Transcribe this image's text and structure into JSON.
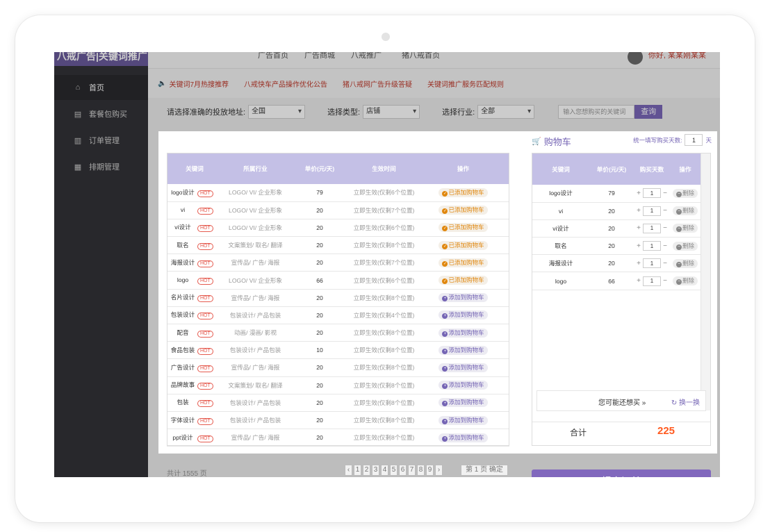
{
  "brand": "八戒广告|关键词推广",
  "sidebar": {
    "items": [
      {
        "label": "首页",
        "icon": "home-icon"
      },
      {
        "label": "套餐包购买",
        "icon": "book-icon"
      },
      {
        "label": "订单管理",
        "icon": "clipboard-icon"
      },
      {
        "label": "排期管理",
        "icon": "calendar-icon"
      }
    ]
  },
  "topnav": {
    "links": [
      "广告首页",
      "广告商城",
      "八戒推广",
      "猪八戒首页"
    ],
    "greeting": "你好,",
    "user": "某某刚某某"
  },
  "notices": [
    "关键词7月热搜推荐",
    "八戒快车产品操作优化公告",
    "猪八戒网广告升级答疑",
    "关键词推广服务匹配规则"
  ],
  "filters": {
    "area_label": "请选择准确的投放地址:",
    "area_value": "全国",
    "type_label": "选择类型:",
    "type_value": "店铺",
    "industry_label": "选择行业:",
    "industry_value": "全部",
    "search_placeholder": "输入您想购买的关键词",
    "search_button": "查询"
  },
  "keyword_table": {
    "headers": [
      "关键词",
      "所属行业",
      "单价(元/天)",
      "生效时间",
      "操作"
    ],
    "hot_label": "HOT",
    "added_label": "已添加购物车",
    "add_label": "添加到购物车",
    "rows": [
      {
        "keyword": "logo设计",
        "industry": "LOGO/ VI/ 企业形象",
        "price": "79",
        "effective": "立即生效(仅剩6个位置)",
        "added": true
      },
      {
        "keyword": "vi",
        "industry": "LOGO/ VI/ 企业形象",
        "price": "20",
        "effective": "立即生效(仅剩7个位置)",
        "added": true
      },
      {
        "keyword": "vi设计",
        "industry": "LOGO/ VI/ 企业形象",
        "price": "20",
        "effective": "立即生效(仅剩6个位置)",
        "added": true
      },
      {
        "keyword": "取名",
        "industry": "文案策划/ 取名/ 翻译",
        "price": "20",
        "effective": "立即生效(仅剩8个位置)",
        "added": true
      },
      {
        "keyword": "海报设计",
        "industry": "宣传品/ 广告/ 海报",
        "price": "20",
        "effective": "立即生效(仅剩7个位置)",
        "added": true
      },
      {
        "keyword": "logo",
        "industry": "LOGO/ VI/ 企业形象",
        "price": "66",
        "effective": "立即生效(仅剩6个位置)",
        "added": true
      },
      {
        "keyword": "名片设计",
        "industry": "宣传品/ 广告/ 海报",
        "price": "20",
        "effective": "立即生效(仅剩8个位置)",
        "added": false
      },
      {
        "keyword": "包装设计",
        "industry": "包装设计/ 产品包装",
        "price": "20",
        "effective": "立即生效(仅剩4个位置)",
        "added": false
      },
      {
        "keyword": "配音",
        "industry": "动画/ 漫画/ 影视",
        "price": "20",
        "effective": "立即生效(仅剩8个位置)",
        "added": false
      },
      {
        "keyword": "食品包装",
        "industry": "包装设计/ 产品包装",
        "price": "10",
        "effective": "立即生效(仅剩8个位置)",
        "added": false
      },
      {
        "keyword": "广告设计",
        "industry": "宣传品/ 广告/ 海报",
        "price": "20",
        "effective": "立即生效(仅剩8个位置)",
        "added": false
      },
      {
        "keyword": "品牌故事",
        "industry": "文案策划/ 取名/ 翻译",
        "price": "20",
        "effective": "立即生效(仅剩8个位置)",
        "added": false
      },
      {
        "keyword": "包装",
        "industry": "包装设计/ 产品包装",
        "price": "20",
        "effective": "立即生效(仅剩8个位置)",
        "added": false
      },
      {
        "keyword": "字体设计",
        "industry": "包装设计/ 产品包装",
        "price": "20",
        "effective": "立即生效(仅剩8个位置)",
        "added": false
      },
      {
        "keyword": "ppt设计",
        "industry": "宣传品/ 广告/ 海报",
        "price": "20",
        "effective": "立即生效(仅剩8个位置)",
        "added": false
      }
    ]
  },
  "cart": {
    "title": "购物车",
    "days_label": "统一填写购买天数:",
    "days_value": "1",
    "days_unit": "天",
    "headers": [
      "关键词",
      "单价(元/天)",
      "购买天数",
      "操作"
    ],
    "delete_label": "删除",
    "items": [
      {
        "keyword": "logo设计",
        "price": "79",
        "days": "1"
      },
      {
        "keyword": "vi",
        "price": "20",
        "days": "1"
      },
      {
        "keyword": "vi设计",
        "price": "20",
        "days": "1"
      },
      {
        "keyword": "取名",
        "price": "20",
        "days": "1"
      },
      {
        "keyword": "海报设计",
        "price": "20",
        "days": "1"
      },
      {
        "keyword": "logo",
        "price": "66",
        "days": "1"
      }
    ],
    "might_buy": "您可能还想买",
    "swap": "换一换",
    "total_label": "合计",
    "total_value": "225",
    "submit": "提交订单"
  },
  "pager": {
    "total": "共计 1555 页",
    "pages": [
      "1",
      "2",
      "3",
      "4",
      "5",
      "6",
      "7",
      "8",
      "9"
    ],
    "jump_prefix": "第",
    "jump_value": "1",
    "jump_suffix": "页",
    "confirm": "确定"
  },
  "colors": {
    "accent": "#7464b4",
    "header": "#c4c0e6",
    "hot": "#e55a4e",
    "added": "#e0870e",
    "total": "#ff5a1f"
  }
}
